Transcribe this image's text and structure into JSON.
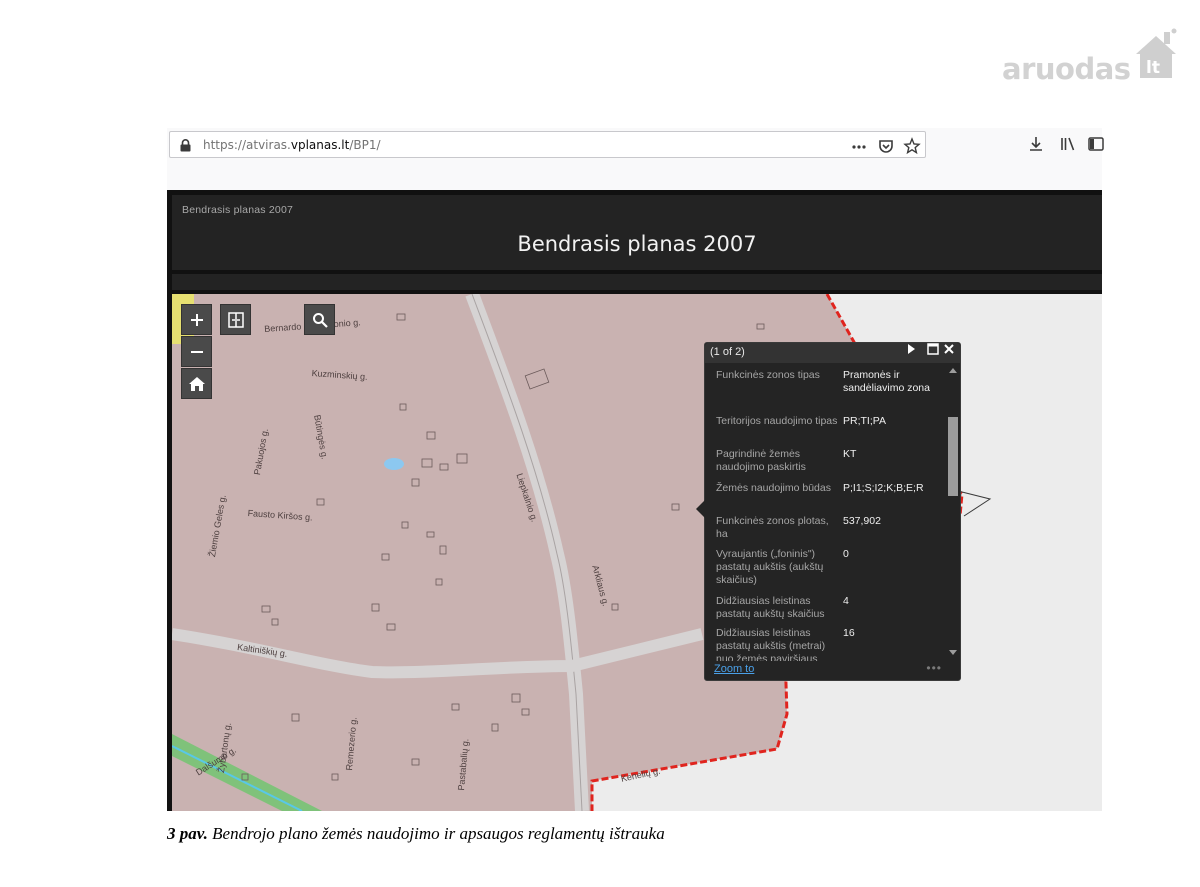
{
  "watermark": {
    "brand": "aruodas",
    "tld": "lt"
  },
  "browser": {
    "url_prefix": "https://atviras.",
    "url_domain": "vplanas.lt",
    "url_path": "/BP1/",
    "icons": [
      "lock-icon",
      "more-icon",
      "pocket-icon",
      "star-icon",
      "download-icon",
      "library-icon",
      "sidebar-icon"
    ]
  },
  "app": {
    "header_small": "Bendrasis planas 2007",
    "header_title": "Bendrasis planas 2007"
  },
  "map": {
    "controls": [
      "zoom-in-icon",
      "zoom-out-icon",
      "home-icon",
      "split-icon",
      "search-icon"
    ],
    "streets": [
      "Bernardo Brazdžionio g.",
      "Kuzminskių g.",
      "Būtingės g.",
      "Pakuojos g.",
      "Žiemio Geles g.",
      "Fausto Kiršos g.",
      "Liepkalnio g.",
      "Arkliaus g.",
      "Kaltiniškių g.",
      "Žybartonų g.",
      "Remezerio g.",
      "Pastabalių g.",
      "Dalšumo g.",
      "Kenelių g."
    ]
  },
  "popup": {
    "count": "(1 of 2)",
    "rows": [
      {
        "key": "Funkcinės zonos tipas",
        "value": "Pramonės ir sandėliavimo zona"
      },
      {
        "key": "Teritorijos naudojimo tipas",
        "value": "PR;TI;PA"
      },
      {
        "key": "Pagrindinė žemės naudojimo paskirtis",
        "value": "KT"
      },
      {
        "key": "Žemės naudojimo būdas",
        "value": "P;I1;S;I2;K;B;E;R"
      },
      {
        "key": "Funkcinės zonos plotas, ha",
        "value": "537,902"
      },
      {
        "key": "Vyraujantis („foninis\") pastatų aukštis (aukštų skaičius)",
        "value": "0"
      },
      {
        "key": "Didžiausias leistinas pastatų aukštų skaičius",
        "value": "4"
      },
      {
        "key": "Didžiausias leistinas pastatų aukštis (metrai) nuo žemės paviršiaus",
        "value": "16"
      }
    ],
    "zoom_link": "Zoom to",
    "more": "•••"
  },
  "caption": {
    "label": "3 pav.",
    "text": "Bendrojo plano žemės naudojimo ir apsaugos reglamentų ištrauka"
  },
  "colors": {
    "zone_fill": "#c9b2b1",
    "road": "#d6d3d3",
    "boundary_red": "#e0241e",
    "outside_area": "#ececec",
    "green_strip": "#7fc27a"
  }
}
